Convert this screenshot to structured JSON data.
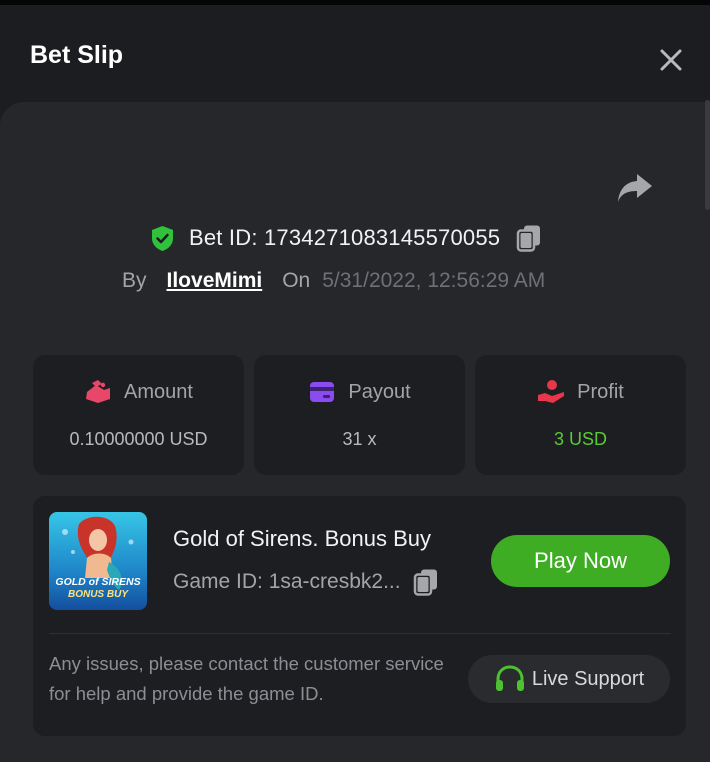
{
  "panel": {
    "title": "Bet Slip"
  },
  "bet": {
    "id_text": "Bet ID: 1734271083145570055",
    "by_label": "By",
    "username": "IloveMimi",
    "on_label": "On",
    "datetime": "5/31/2022, 12:56:29 AM"
  },
  "stats": [
    {
      "label": "Amount",
      "value": "0.10000000 USD",
      "icon": "amount-icon",
      "icon_color": "#e8476a"
    },
    {
      "label": "Payout",
      "value": "31 x",
      "icon": "payout-card-icon",
      "icon_color": "#8a4cf0"
    },
    {
      "label": "Profit",
      "value": "3 USD",
      "icon": "profit-hand-icon",
      "icon_color": "#e8364a",
      "value_color": "#5bc936"
    }
  ],
  "game": {
    "name": "Gold of Sirens. Bonus Buy",
    "id_text": "Game ID: 1sa-cresbk2...",
    "thumb_title_line1": "GOLD of SIRENS",
    "thumb_title_line2": "BONUS BUY",
    "play_label": "Play Now",
    "notice": "Any issues, please contact the customer service for help and provide the game ID.",
    "support_label": "Live Support"
  },
  "colors": {
    "accent_green": "#3fad24",
    "shield_green": "#2fc23a",
    "background": "#1c1d20",
    "card": "#26272b"
  }
}
